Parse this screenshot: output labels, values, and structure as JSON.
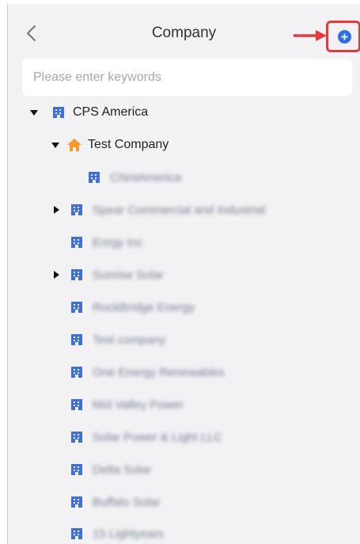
{
  "header": {
    "title": "Company",
    "back_icon": "chevron-left-icon",
    "add_icon": "plus-circle-icon"
  },
  "search": {
    "placeholder": "Please enter keywords",
    "value": ""
  },
  "colors": {
    "accent": "#2f6fe6",
    "building_icon": "#3d6fe0",
    "home_icon": "#f39a2b",
    "highlight": "#e23b3b",
    "background": "#f2f2f4"
  },
  "tree": [
    {
      "label": "CPS America",
      "icon": "building-icon",
      "expanded": true,
      "level": 0
    },
    {
      "label": "Test Company",
      "icon": "home-icon",
      "expanded": true,
      "level": 1
    },
    {
      "label": "ChintAmerica",
      "icon": "building-icon",
      "level": 2,
      "blurred": true
    },
    {
      "label": "Spear Commercial and Industrial",
      "icon": "building-icon",
      "expandable": true,
      "level": 1,
      "blurred": true
    },
    {
      "label": "Enrgy Inc",
      "icon": "building-icon",
      "level": 1,
      "blurred": true
    },
    {
      "label": "Sunrise Solar",
      "icon": "building-icon",
      "expandable": true,
      "level": 1,
      "blurred": true
    },
    {
      "label": "RockBridge Energy",
      "icon": "building-icon",
      "level": 1,
      "blurred": true
    },
    {
      "label": "Test company",
      "icon": "building-icon",
      "level": 1,
      "blurred": true
    },
    {
      "label": "One Energy Renewables",
      "icon": "building-icon",
      "level": 1,
      "blurred": true
    },
    {
      "label": "Mid Valley Power",
      "icon": "building-icon",
      "level": 1,
      "blurred": true
    },
    {
      "label": "Solar Power & Light LLC",
      "icon": "building-icon",
      "level": 1,
      "blurred": true
    },
    {
      "label": "Delta Solar",
      "icon": "building-icon",
      "level": 1,
      "blurred": true
    },
    {
      "label": "Buffalo Solar",
      "icon": "building-icon",
      "level": 1,
      "blurred": true
    },
    {
      "label": "15 Lightyears",
      "icon": "building-icon",
      "level": 1,
      "blurred": true
    }
  ]
}
